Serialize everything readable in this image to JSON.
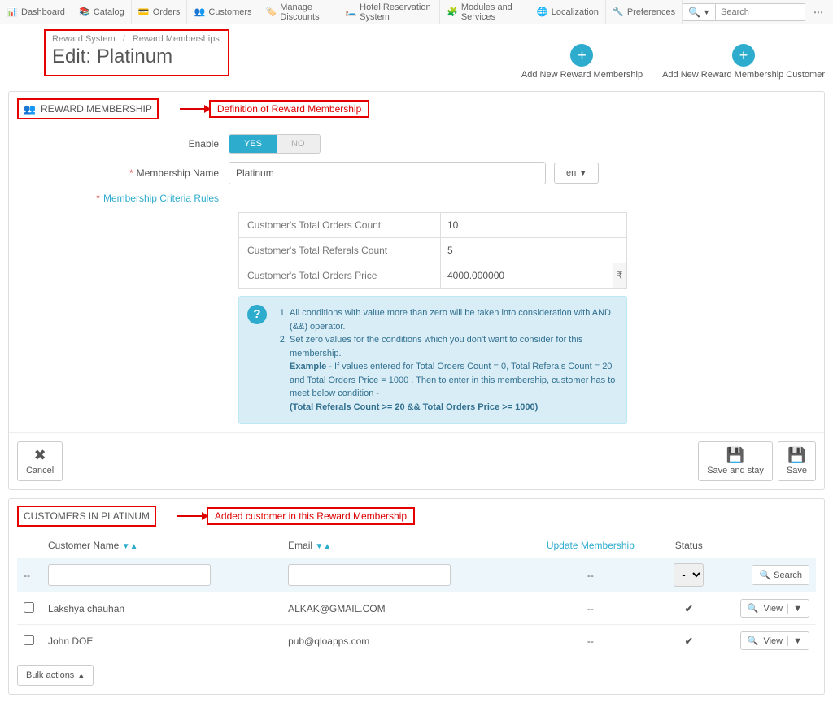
{
  "nav": {
    "items": [
      {
        "label": "Dashboard"
      },
      {
        "label": "Catalog"
      },
      {
        "label": "Orders"
      },
      {
        "label": "Customers"
      },
      {
        "label": "Manage Discounts"
      },
      {
        "label": "Hotel Reservation System"
      },
      {
        "label": "Modules and Services"
      },
      {
        "label": "Localization"
      },
      {
        "label": "Preferences"
      }
    ],
    "search_placeholder": "Search"
  },
  "breadcrumb": {
    "a": "Reward System",
    "b": "Reward Memberships"
  },
  "page_title": "Edit: Platinum",
  "header_actions": {
    "add_membership": "Add New Reward Membership",
    "add_customer": "Add New Reward Membership Customer"
  },
  "panel1": {
    "heading": "REWARD MEMBERSHIP",
    "annot": "Definition of Reward Membership",
    "labels": {
      "enable": "Enable",
      "yes": "YES",
      "no": "NO",
      "name": "Membership Name",
      "criteria": "Membership Criteria Rules",
      "lang": "en"
    },
    "name_value": "Platinum",
    "criteria": [
      {
        "label": "Customer's Total Orders Count",
        "value": "10"
      },
      {
        "label": "Customer's Total Referals Count",
        "value": "5"
      },
      {
        "label": "Customer's Total Orders Price",
        "value": "4000.000000",
        "currency": "₹"
      }
    ],
    "info": {
      "l1": "All conditions with value more than zero will be taken into consideration with AND (&&) operator.",
      "l2a": "Set zero values for the conditions which you don't want to consider for this membership.",
      "l2b_pre": "Example",
      "l2b": " - If values entered for Total Orders Count = 0, Total Referals Count = 20 and Total Orders Price = 1000 . Then to enter in this membership, customer has to meet below condition -",
      "l2c": "(Total Referals Count >= 20 && Total Orders Price >= 1000)"
    },
    "buttons": {
      "cancel": "Cancel",
      "savestay": "Save and stay",
      "save": "Save"
    }
  },
  "panel2": {
    "heading": "CUSTOMERS IN PLATINUM",
    "annot": "Added customer in this Reward Membership",
    "cols": {
      "name": "Customer Name",
      "email": "Email",
      "update": "Update Membership",
      "status": "Status"
    },
    "search": "Search",
    "filter_status_default": "-",
    "rows": [
      {
        "name": "Lakshya chauhan",
        "email": "ALKAK@GMAIL.COM",
        "update": "--"
      },
      {
        "name": "John DOE",
        "email": "pub@qloapps.com",
        "update": "--"
      }
    ],
    "view": "View",
    "bulk": "Bulk actions"
  }
}
